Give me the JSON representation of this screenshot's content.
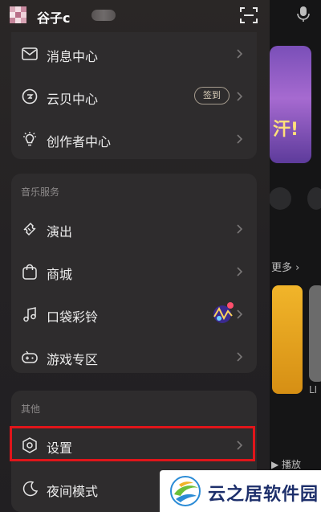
{
  "header": {
    "username": "谷子c",
    "scan_icon": "scan-icon"
  },
  "top_group": {
    "items": [
      {
        "label": "消息中心",
        "icon": "mail-icon"
      },
      {
        "label": "云贝中心",
        "icon": "coin-icon",
        "badge": "签到"
      },
      {
        "label": "创作者中心",
        "icon": "lightbulb-icon"
      }
    ]
  },
  "music_services": {
    "title": "音乐服务",
    "items": [
      {
        "label": "演出",
        "icon": "ticket-icon"
      },
      {
        "label": "商城",
        "icon": "shopping-bag-icon"
      },
      {
        "label": "口袋彩铃",
        "icon": "music-note-icon"
      },
      {
        "label": "游戏专区",
        "icon": "gamepad-icon"
      }
    ]
  },
  "other": {
    "title": "其他",
    "items": [
      {
        "label": "设置",
        "icon": "gear-icon"
      },
      {
        "label": "夜间模式",
        "icon": "moon-icon"
      }
    ]
  },
  "background": {
    "more_label": "更多",
    "card_label": "LI",
    "play_label": "播放"
  },
  "watermark": {
    "text": "云之居软件园"
  },
  "colors": {
    "drawer_bg": "#2a2726",
    "card_bg": "#2e2c2d",
    "highlight": "#e0151a",
    "watermark_text": "#1d2f6b"
  }
}
